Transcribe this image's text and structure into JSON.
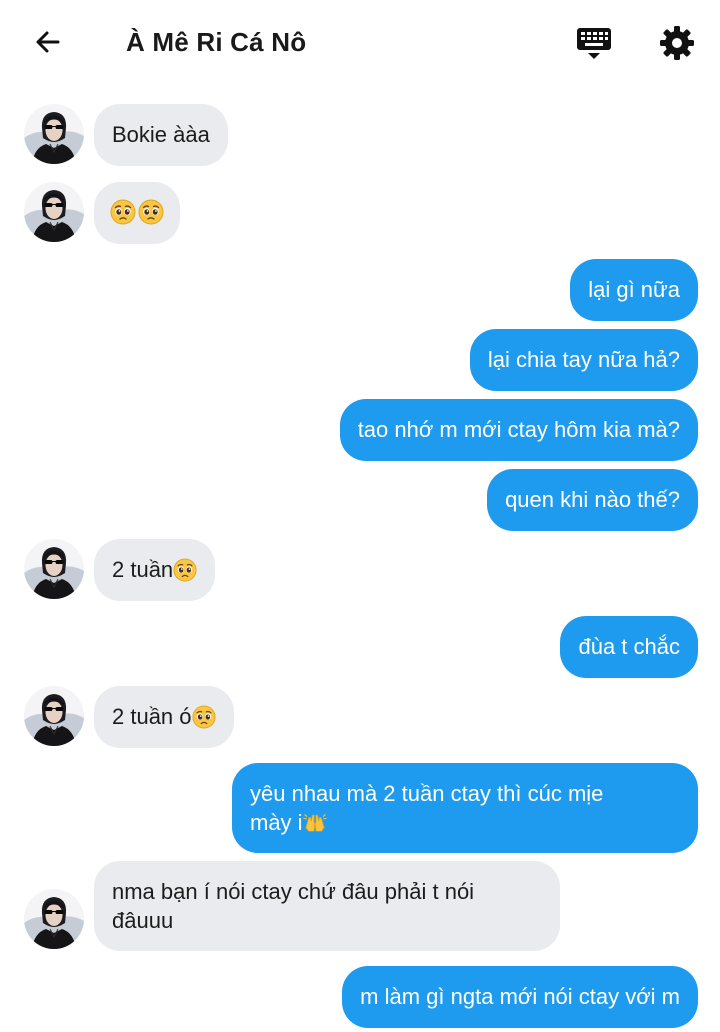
{
  "header": {
    "title": "À Mê Ri Cá Nô",
    "back_icon": "arrow-left-icon",
    "keyboard_icon": "keyboard-icon",
    "settings_icon": "gear-icon"
  },
  "colors": {
    "outgoing_bubble": "#1e9bef",
    "incoming_bubble": "#e9ebee"
  },
  "messages": [
    {
      "direction": "in",
      "text": "Bokie ààa"
    },
    {
      "direction": "in",
      "text": "",
      "emojis": [
        "pleading-face",
        "pleading-face"
      ]
    },
    {
      "direction": "out",
      "text": "lại gì nữa"
    },
    {
      "direction": "out",
      "text": "lại chia tay nữa hả?"
    },
    {
      "direction": "out",
      "text": "tao nhớ m mới ctay hôm kia mà?"
    },
    {
      "direction": "out",
      "text": "quen khi nào thế?"
    },
    {
      "direction": "in",
      "text": "2 tuần",
      "emojis": [
        "pleading-face"
      ]
    },
    {
      "direction": "out",
      "text": "đùa t chắc"
    },
    {
      "direction": "in",
      "text": "2 tuần ó",
      "emojis": [
        "pleading-face"
      ]
    },
    {
      "direction": "out",
      "text_line1": "yêu nhau mà 2 tuần ctay thì cúc mịe",
      "text_line2": "mày i",
      "emojis": [
        "raising-hands"
      ]
    },
    {
      "direction": "in",
      "text_line1": "nma bạn í nói ctay chứ đâu phải t nói",
      "text_line2": "đâuuu"
    },
    {
      "direction": "out",
      "text": "m làm gì ngta mới nói ctay với m"
    }
  ]
}
